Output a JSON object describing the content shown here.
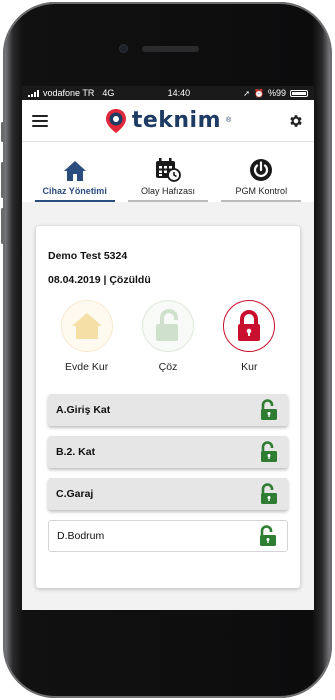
{
  "status_bar": {
    "carrier": "vodafone TR",
    "network": "4G",
    "time": "14:40",
    "battery": "%99"
  },
  "app": {
    "logo_text": "teknim",
    "logo_mark": "®"
  },
  "tabs": [
    {
      "label": "Cihaz Yönetimi",
      "icon": "home-icon",
      "active": true
    },
    {
      "label": "Olay Hafızası",
      "icon": "calendar-clock-icon",
      "active": false
    },
    {
      "label": "PGM Kontrol",
      "icon": "power-icon",
      "active": false
    }
  ],
  "panel": {
    "name": "Demo Test 5324",
    "status": "08.04.2019 | Çözüldü"
  },
  "modes": [
    {
      "label": "Evde Kur",
      "icon": "home-arm-icon"
    },
    {
      "label": "Çöz",
      "icon": "unlock-icon"
    },
    {
      "label": "Kur",
      "icon": "lock-icon"
    }
  ],
  "zones": [
    {
      "name": "A.Giriş Kat",
      "state": "unlocked"
    },
    {
      "name": "B.2. Kat",
      "state": "unlocked"
    },
    {
      "name": "C.Garaj",
      "state": "unlocked"
    },
    {
      "name": "D.Bodrum",
      "state": "unlocked"
    }
  ],
  "colors": {
    "brand_navy": "#1d3b63",
    "brand_red": "#e0283a",
    "lock_red": "#c8102e",
    "zone_green": "#2e7d32",
    "home_amber": "#f6dfa5",
    "unlock_green": "#cfe1cc"
  }
}
